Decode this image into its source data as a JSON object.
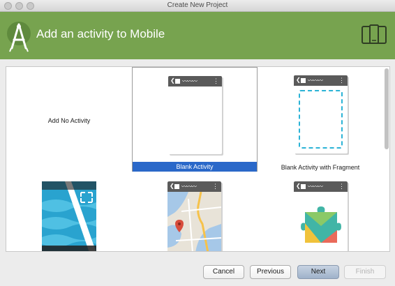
{
  "window": {
    "title": "Create New Project"
  },
  "header": {
    "title": "Add an activity to Mobile",
    "background": "#77a34f"
  },
  "gallery": {
    "templates": [
      {
        "label": "Add No Activity",
        "selected": false
      },
      {
        "label": "Blank Activity",
        "selected": true
      },
      {
        "label": "Blank Activity with Fragment",
        "selected": false
      },
      {
        "label": "",
        "selected": false
      },
      {
        "label": "",
        "selected": false
      },
      {
        "label": "",
        "selected": false
      }
    ],
    "phone_back_glyph": "❮",
    "phone_wave": "〰〰〰",
    "phone_menu": "⋮"
  },
  "buttons": {
    "cancel": "Cancel",
    "previous": "Previous",
    "next": "Next",
    "finish": "Finish"
  },
  "colors": {
    "selection": "#2a68c9",
    "accent_cyan": "#2bb3d6"
  }
}
